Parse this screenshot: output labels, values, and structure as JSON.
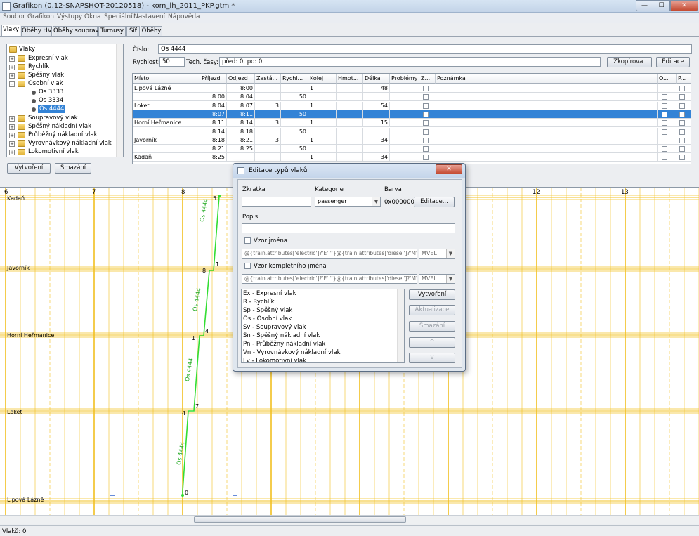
{
  "window": {
    "title": "Grafikon (0.12-SNAPSHOT-20120518) - kom_lh_2011_PKP.gtm *",
    "min": "—",
    "max": "☐",
    "close": "✕"
  },
  "menu": [
    "Soubor",
    "Grafikon",
    "Výstupy",
    "Okna",
    "Speciální",
    "Nastavení",
    "Nápověda"
  ],
  "tabs": [
    "Vlaky",
    "Oběhy HV",
    "Oběhy souprav",
    "Turnusy",
    "Síť",
    "Oběhy"
  ],
  "tree": {
    "root": "Vlaky",
    "items": [
      "Expresní vlak",
      "Rychlík",
      "Spěšný vlak",
      "Osobní vlak",
      "Os 3333",
      "Os 3334",
      "Os 4444",
      "Soupravový vlak",
      "Spěšný nákladní vlak",
      "Průběžný nákladní vlak",
      "Vyrovnávkový nákladní vlak",
      "Lokomotivní vlak"
    ],
    "selected": "Os 4444"
  },
  "left_buttons": {
    "create": "Vytvoření",
    "delete": "Smazání"
  },
  "train": {
    "number_label": "Číslo:",
    "number": "Os 4444",
    "speed_label": "Rychlost:",
    "speed": "50",
    "tech_label": "Tech. časy:",
    "tech": "před: 0, po: 0",
    "copy_button": "Zkopírovat",
    "edit_button": "Editace"
  },
  "table": {
    "headers": [
      "Místo",
      "Příjezd",
      "Odjezd",
      "Zastá...",
      "Rychl...",
      "Kolej",
      "Hmot...",
      "Délka",
      "Problémy",
      "Z...",
      "Poznámka",
      "O...",
      "P..."
    ],
    "rows": [
      [
        "Lipová Lázně",
        "",
        "8:00",
        "",
        "",
        "1",
        "",
        "48"
      ],
      [
        "",
        "8:00",
        "8:04",
        "",
        "50",
        "",
        "",
        ""
      ],
      [
        "Loket",
        "8:04",
        "8:07",
        "3",
        "",
        "1",
        "",
        "54"
      ],
      [
        "",
        "8:07",
        "8:11",
        "",
        "50",
        "",
        "",
        ""
      ],
      [
        "Horní Heřmanice",
        "8:11",
        "8:14",
        "3",
        "",
        "1",
        "",
        "15"
      ],
      [
        "",
        "8:14",
        "8:18",
        "",
        "50",
        "",
        "",
        ""
      ],
      [
        "Javorník",
        "8:18",
        "8:21",
        "3",
        "",
        "1",
        "",
        "34"
      ],
      [
        "",
        "8:21",
        "8:25",
        "",
        "50",
        "",
        "",
        ""
      ],
      [
        "Kadaň",
        "8:25",
        "",
        "",
        "",
        "1",
        "",
        "34"
      ]
    ],
    "selected_row": 3
  },
  "graph": {
    "hours": [
      "6",
      "7",
      "8",
      "12",
      "13"
    ],
    "stations": [
      "Kadaň",
      "Javorník",
      "Horní Heřmanice",
      "Loket",
      "Lipová Lázně"
    ],
    "train_label": "Os 4444",
    "markers": [
      "5",
      "8",
      "1",
      "4",
      "1",
      "4",
      "7",
      "0"
    ],
    "line_color": "#33dd33",
    "hour_color": "#f2c020"
  },
  "status": {
    "text": "Vlaků: 0"
  },
  "dialog": {
    "title": "Editace typů vlaků",
    "abbr_label": "Zkratka",
    "category_label": "Kategorie",
    "category_value": "passenger",
    "color_label": "Barva",
    "color_value": "0x000000",
    "color_button": "Editace...",
    "desc_label": "Popis",
    "name_pattern_label": "Vzor jména",
    "name_pattern_value": "@{train.attributes['electric']?'E':''}@{train.attributes['diesel']?'M':''}",
    "name_pattern_mode": "MVEL",
    "full_pattern_label": "Vzor kompletního jména",
    "full_pattern_value": "@{train.attributes['electric']?'E':''}@{train.attributes['diesel']?'M':''}",
    "full_pattern_mode": "MVEL",
    "types": [
      "Ex - Expresní vlak",
      "R - Rychlík",
      "Sp - Spěšný vlak",
      "Os - Osobní vlak",
      "Sv - Soupravový vlak",
      "Sn - Spěšný nákladní vlak",
      "Pn - Průběžný nákladní vlak",
      "Vn - Vyrovnávkový nákladní vlak",
      "Lv - Lokomotivní vlak"
    ],
    "buttons": {
      "create": "Vytvoření",
      "update": "Aktualizace",
      "delete": "Smazání",
      "up": "^",
      "down": "v"
    }
  }
}
